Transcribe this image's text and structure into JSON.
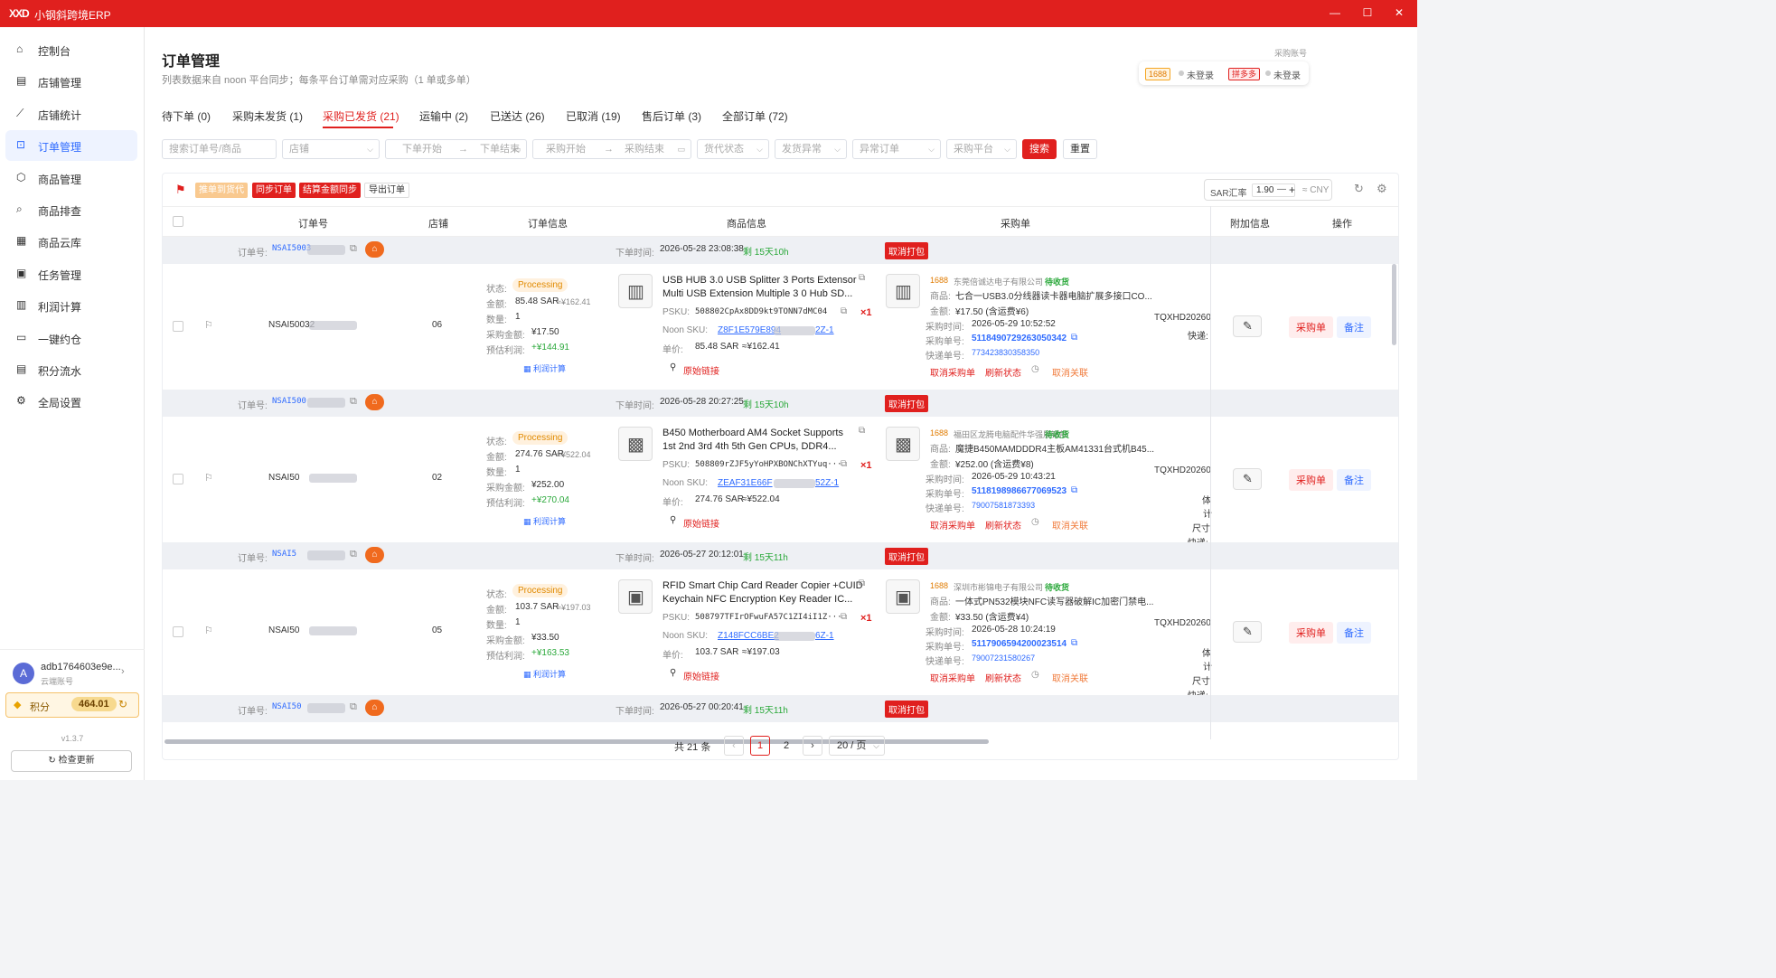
{
  "app": {
    "logo": "XXD",
    "title": "小钢斜跨境ERP"
  },
  "sidebar": {
    "items": [
      {
        "label": "控制台",
        "icon": "home-icon"
      },
      {
        "label": "店铺管理",
        "icon": "store-icon"
      },
      {
        "label": "店铺统计",
        "icon": "chart-icon"
      },
      {
        "label": "订单管理",
        "icon": "cart-icon"
      },
      {
        "label": "商品管理",
        "icon": "box-icon"
      },
      {
        "label": "商品排查",
        "icon": "search-icon"
      },
      {
        "label": "商品云库",
        "icon": "cloud-store-icon"
      },
      {
        "label": "任务管理",
        "icon": "clipboard-icon"
      },
      {
        "label": "利润计算",
        "icon": "calculator-icon"
      },
      {
        "label": "一键约仓",
        "icon": "calendar-icon"
      },
      {
        "label": "积分流水",
        "icon": "ledger-icon"
      },
      {
        "label": "全局设置",
        "icon": "gear-icon"
      }
    ],
    "active_index": 3,
    "user": {
      "avatar": "A",
      "name": "adb1764603e9e...",
      "role": "云端账号"
    },
    "points": {
      "label": "积分",
      "value": "464.01"
    },
    "version": "v1.3.7",
    "check_update": "检查更新"
  },
  "page": {
    "title": "订单管理",
    "subtitle": "列表数据来自 noon 平台同步；每条平台订单需对应采购（1 单或多单）",
    "purchase_account_label": "采购账号",
    "accounts": [
      {
        "tag": "1688",
        "status": "未登录"
      },
      {
        "tag": "拼多多",
        "status": "未登录"
      }
    ]
  },
  "tabs": [
    {
      "label": "待下单 (0)"
    },
    {
      "label": "采购未发货 (1)"
    },
    {
      "label": "采购已发货 (21)",
      "active": true
    },
    {
      "label": "运输中 (2)"
    },
    {
      "label": "已送达 (26)"
    },
    {
      "label": "已取消 (19)"
    },
    {
      "label": "售后订单 (3)"
    },
    {
      "label": "全部订单 (72)"
    }
  ],
  "filters": {
    "search_placeholder": "搜索订单号/商品",
    "store": "店铺",
    "order_start": "下单开始",
    "order_end": "下单结束",
    "purchase_start": "采购开始",
    "purchase_end": "采购结束",
    "agent_status": "货代状态",
    "ship_exception": "发货异常",
    "exception_order": "异常订单",
    "purchase_platform": "采购平台",
    "arrow": "→",
    "search_btn": "搜索",
    "reset_btn": "重置"
  },
  "toolbar": {
    "push_agent": "推单到货代",
    "sync_orders": "同步订单",
    "sync_settlement": "结算金额同步",
    "export_orders": "导出订单",
    "sar_label": "SAR汇率",
    "sar_value": "1.90",
    "minus": "—",
    "plus": "+",
    "cny": "≈ CNY"
  },
  "columns": {
    "order_no": "订单号",
    "store": "店铺",
    "order_info": "订单信息",
    "product_info": "商品信息",
    "purchase": "采购单",
    "extra_info": "附加信息",
    "actions": "操作"
  },
  "labels": {
    "order_no": "订单号:",
    "order_time": "下单时间:",
    "cancel_pack": "取消打包",
    "status": "状态:",
    "amount": "金额:",
    "qty": "数量:",
    "purchase_amount": "采购金额:",
    "est_profit": "预估利润:",
    "profit_calc": "利润计算",
    "psku": "PSKU:",
    "noon_sku": "Noon SKU:",
    "unit_price": "单价:",
    "original_link": "原始链接",
    "product": "商品:",
    "amount2": "金额:",
    "purchase_time": "采购时间:",
    "purchase_no": "采购单号:",
    "express_no": "快递单号:",
    "cancel_purchase": "取消采购单",
    "refresh_status": "刷新状态",
    "cancel_link": "取消关联",
    "purchase_btn": "采购单",
    "note_btn": "备注",
    "express_short": "快递:",
    "extra_a": "体",
    "extra_b": "计",
    "extra_c": "尺寸",
    "extra_d": "快递:",
    "extra_e": "体",
    "extra_f": "计",
    "extra_g": "尺寸",
    "extra_h": "快递:"
  },
  "orders": [
    {
      "order_no": "NSAI5003",
      "order_no_row": "NSAI50032",
      "store": "06",
      "order_time": "2026-05-28 23:08:38",
      "elapsed": "剩 15天10h",
      "status": "Processing",
      "amount": "85.48 SAR",
      "amount_cny": "≈¥162.41",
      "qty": "1",
      "purchase_amount": "¥17.50",
      "profit": "+¥144.91",
      "title1": "USB HUB 3.0 USB Splitter 3 Ports Extensor",
      "title2": "Multi USB Extension Multiple 3 0 Hub SD...",
      "psku": "508802CpAx8DD9kt9TONN7dMC04",
      "noon_sku_a": "Z8F1E579E894",
      "noon_sku_b": "2Z-1",
      "multiplier": "×1",
      "unit_price": "85.48 SAR",
      "unit_price_cny": "≈¥162.41",
      "supplier": "东莞倍诚达电子有限公司",
      "supplier_status": "待收货",
      "purchase_product": "七合一USB3.0分线器读卡器电脑扩展多接口CO...",
      "purchase_amount2": "¥17.50 (含运费¥6)",
      "purchase_time": "2026-05-29 10:52:52",
      "purchase_no": "5118490729263050342",
      "express_no": "773423830358350",
      "extra_code": "TQXHD20260"
    },
    {
      "order_no": "NSAI500",
      "order_no_row": "NSAI50",
      "store": "02",
      "order_time": "2026-05-28 20:27:25",
      "elapsed": "剩 15天10h",
      "status": "Processing",
      "amount": "274.76 SAR",
      "amount_cny": "≈¥522.04",
      "qty": "1",
      "purchase_amount": "¥252.00",
      "profit": "+¥270.04",
      "title1": "B450 Motherboard AM4 Socket Supports",
      "title2": "1st 2nd 3rd 4th 5th Gen CPUs, DDR4...",
      "psku": "508809rZJF5yYoHPXBONChXTYuq···",
      "noon_sku_a": "ZEAF31E66F",
      "noon_sku_b": "52Z-1",
      "multiplier": "×1",
      "unit_price": "274.76 SAR",
      "unit_price_cny": "≈¥522.04",
      "supplier": "福田区龙腾电脑配件华强展销部",
      "supplier_status": "待收货",
      "purchase_product": "魔捷B450MAMDDDR4主板AM41331台式机B45...",
      "purchase_amount2": "¥252.00 (含运费¥8)",
      "purchase_time": "2026-05-29 10:43:21",
      "purchase_no": "5118198986677069523",
      "express_no": "79007581873393",
      "extra_code": "TQXHD20260"
    },
    {
      "order_no": "NSAI5",
      "order_no_row": "NSAI50",
      "store": "05",
      "order_time": "2026-05-27 20:12:01",
      "elapsed": "剩 15天11h",
      "status": "Processing",
      "amount": "103.7 SAR",
      "amount_cny": "≈¥197.03",
      "qty": "1",
      "purchase_amount": "¥33.50",
      "profit": "+¥163.53",
      "title1": "RFID Smart Chip Card Reader Copier +CUID",
      "title2": "Keychain NFC Encryption Key Reader IC...",
      "psku": "508797TFIrOFwuFA57C1ZI4iI1Z···",
      "noon_sku_a": "Z148FCC6BE2",
      "noon_sku_b": "6Z-1",
      "multiplier": "×1",
      "unit_price": "103.7 SAR",
      "unit_price_cny": "≈¥197.03",
      "supplier": "深圳市彬锦电子有限公司",
      "supplier_status": "待收货",
      "purchase_product": "一体式PN532模块NFC读写器破解IC加密门禁电...",
      "purchase_amount2": "¥33.50 (含运费¥4)",
      "purchase_time": "2026-05-28 10:24:19",
      "purchase_no": "5117906594200023514",
      "express_no": "79007231580267",
      "extra_code": "TQXHD20260"
    },
    {
      "order_no": "NSAI50",
      "order_time": "2026-05-27 00:20:41",
      "elapsed": "剩 15天11h"
    }
  ],
  "pager": {
    "total": "共 21 条",
    "prev": "‹",
    "next": "›",
    "pages": [
      "1",
      "2"
    ],
    "current": "1",
    "page_size": "20 / 页"
  },
  "colors": {
    "brand": "#e0201e",
    "link": "#2f6bff",
    "profit": "#2aa83a"
  }
}
